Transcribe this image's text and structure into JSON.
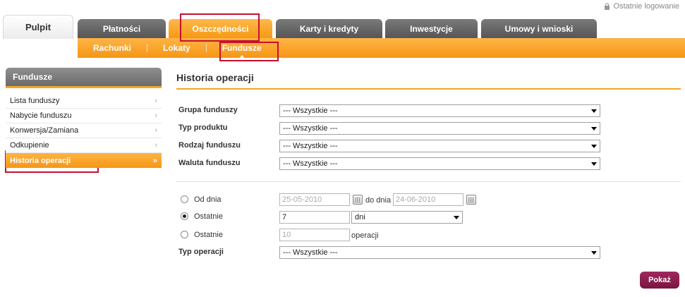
{
  "header": {
    "last_login": "Ostatnie logowanie"
  },
  "tabs": [
    {
      "label": "Pulpit"
    },
    {
      "label": "Płatności"
    },
    {
      "label": "Oszczędności"
    },
    {
      "label": "Karty i kredyty"
    },
    {
      "label": "Inwestycje"
    },
    {
      "label": "Umowy i wnioski"
    }
  ],
  "subnav": [
    {
      "label": "Rachunki"
    },
    {
      "label": "Lokaty"
    },
    {
      "label": "Fundusze"
    }
  ],
  "sidebar": {
    "title": "Fundusze",
    "items": [
      {
        "label": "Lista funduszy",
        "chevron": "›"
      },
      {
        "label": "Nabycie funduszu",
        "chevron": "›"
      },
      {
        "label": "Konwersja/Zamiana",
        "chevron": "›"
      },
      {
        "label": "Odkupienie",
        "chevron": "›"
      },
      {
        "label": "Historia operacji",
        "chevron": "»"
      }
    ]
  },
  "main": {
    "title": "Historia operacji",
    "fields": [
      {
        "label": "Grupa funduszy",
        "value": "--- Wszystkie ---"
      },
      {
        "label": "Typ produktu",
        "value": "---  Wszystkie  ---"
      },
      {
        "label": "Rodzaj funduszu",
        "value": "---  Wszystkie  ---"
      },
      {
        "label": "Waluta funduszu",
        "value": "---  Wszystkie  ---"
      }
    ],
    "range": {
      "from_label": "Od dnia",
      "from_value": "25-05-2010",
      "to_label": "do dnia",
      "to_value": "24-06-2010",
      "last_label": "Ostatnie",
      "last_value": "7",
      "last_unit": "dni",
      "last_ops_label": "Ostatnie",
      "last_ops_value": "10",
      "last_ops_unit": "operacji"
    },
    "op_type": {
      "label": "Typ operacji",
      "value": "--- Wszystkie ---"
    },
    "submit": "Pokaż"
  },
  "colors": {
    "accent": "#f5a623",
    "button": "#8b1a4c",
    "highlight": "#c8102e"
  }
}
